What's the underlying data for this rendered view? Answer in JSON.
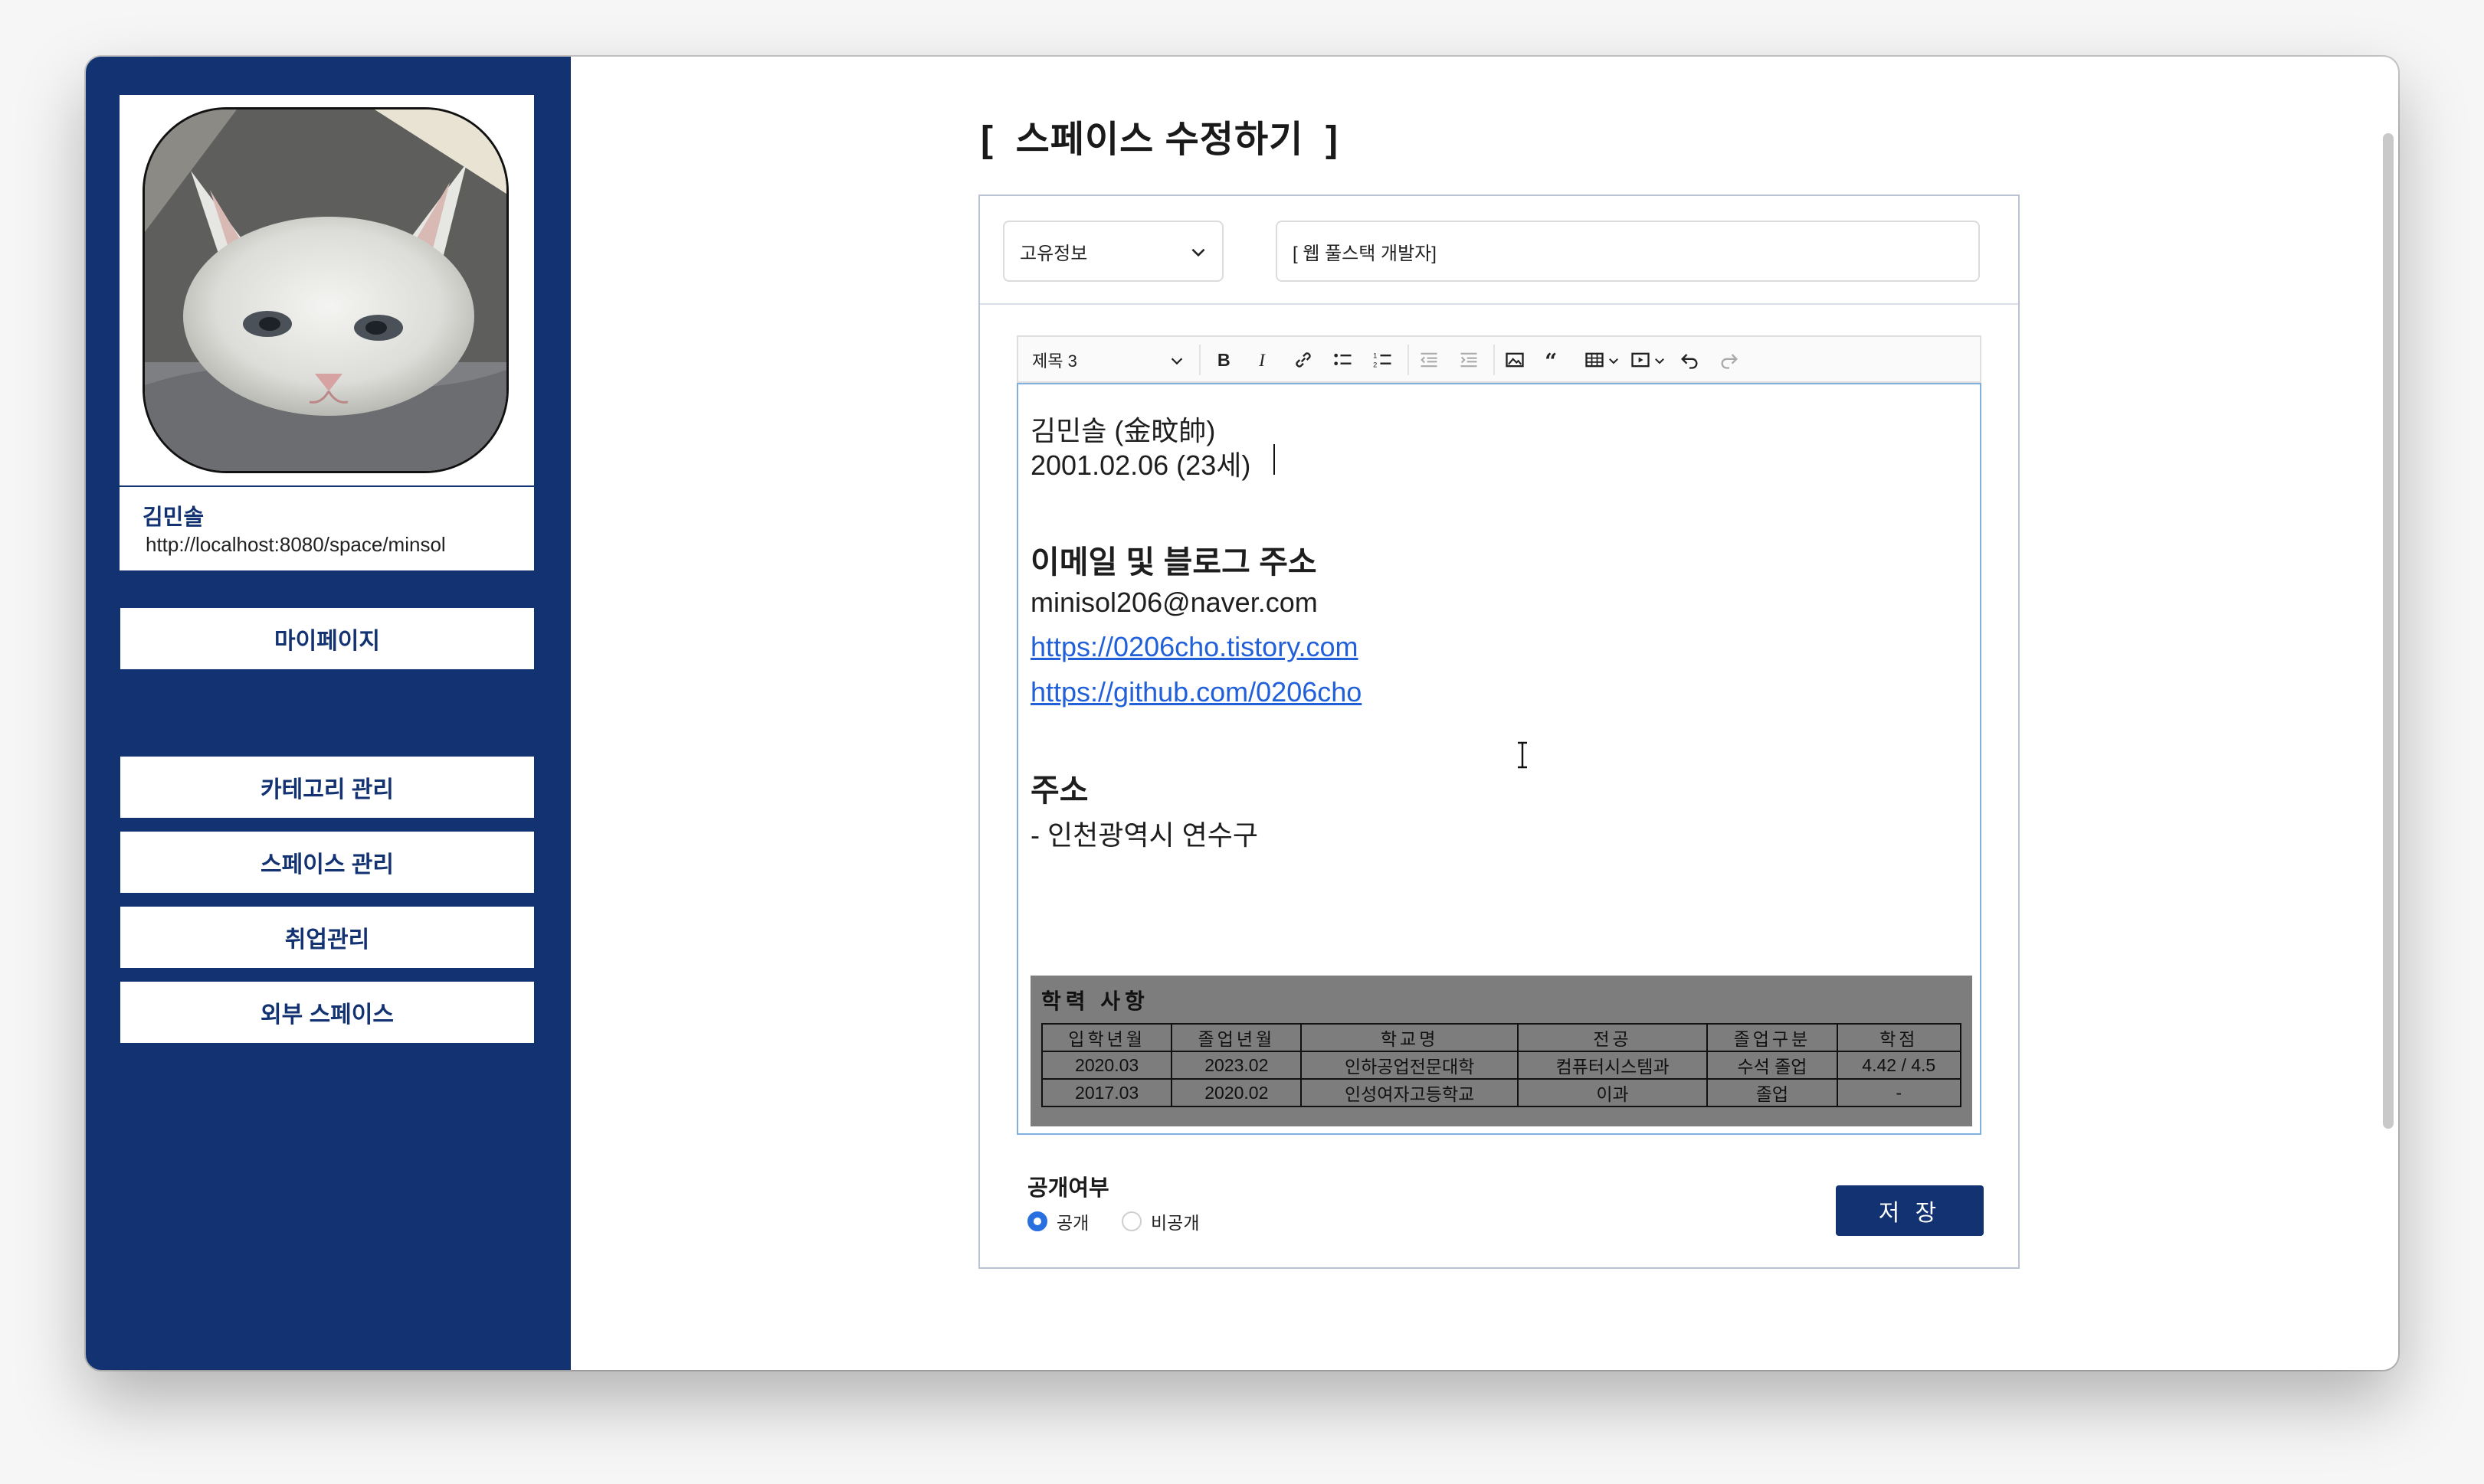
{
  "sidebar": {
    "profile": {
      "name": "김민솔",
      "url": "http://localhost:8080/space/minsol"
    },
    "nav": {
      "mypage": "마이페이지",
      "category": "카테고리 관리",
      "space": "스페이스 관리",
      "job": "취업관리",
      "external": "외부 스페이스"
    }
  },
  "page": {
    "title": "[  스페이스 수정하기  ]"
  },
  "form": {
    "category_select": "고유정보",
    "title_value": "[ 웹 풀스택 개발자]",
    "toolbar": {
      "heading": "제목 3",
      "icons": [
        "bold-icon",
        "italic-icon",
        "link-icon",
        "bulleted-list-icon",
        "numbered-list-icon",
        "outdent-icon",
        "indent-icon",
        "image-icon",
        "blockquote-icon",
        "table-icon",
        "media-icon",
        "undo-icon",
        "redo-icon"
      ]
    },
    "content": {
      "name_line": "김민솔 (金旼帥)",
      "birth_line": "2001.02.06 (23세)",
      "contact_heading": "이메일 및 블로그 주소",
      "email": "minisol206@naver.com",
      "blog_link": "https://0206cho.tistory.com",
      "github_link": "https://github.com/0206cho",
      "address_heading": "주소",
      "address": "- 인천광역시 연수구",
      "education": {
        "title": "학력 사항",
        "headers": [
          "입학년월",
          "졸업년월",
          "학교명",
          "전공",
          "졸업구분",
          "학점"
        ],
        "rows": [
          [
            "2020.03",
            "2023.02",
            "인하공업전문대학",
            "컴퓨터시스템과",
            "수석 졸업",
            "4.42 / 4.5"
          ],
          [
            "2017.03",
            "2020.02",
            "인성여자고등학교",
            "이과",
            "졸업",
            "-"
          ]
        ]
      }
    },
    "visibility": {
      "label": "공개여부",
      "public": "공개",
      "private": "비공개",
      "selected": "공개"
    },
    "save_label": "저 장"
  },
  "colors": {
    "sidebar": "#123272",
    "accent_blue": "#2a6fe0",
    "link": "#2160d9"
  }
}
